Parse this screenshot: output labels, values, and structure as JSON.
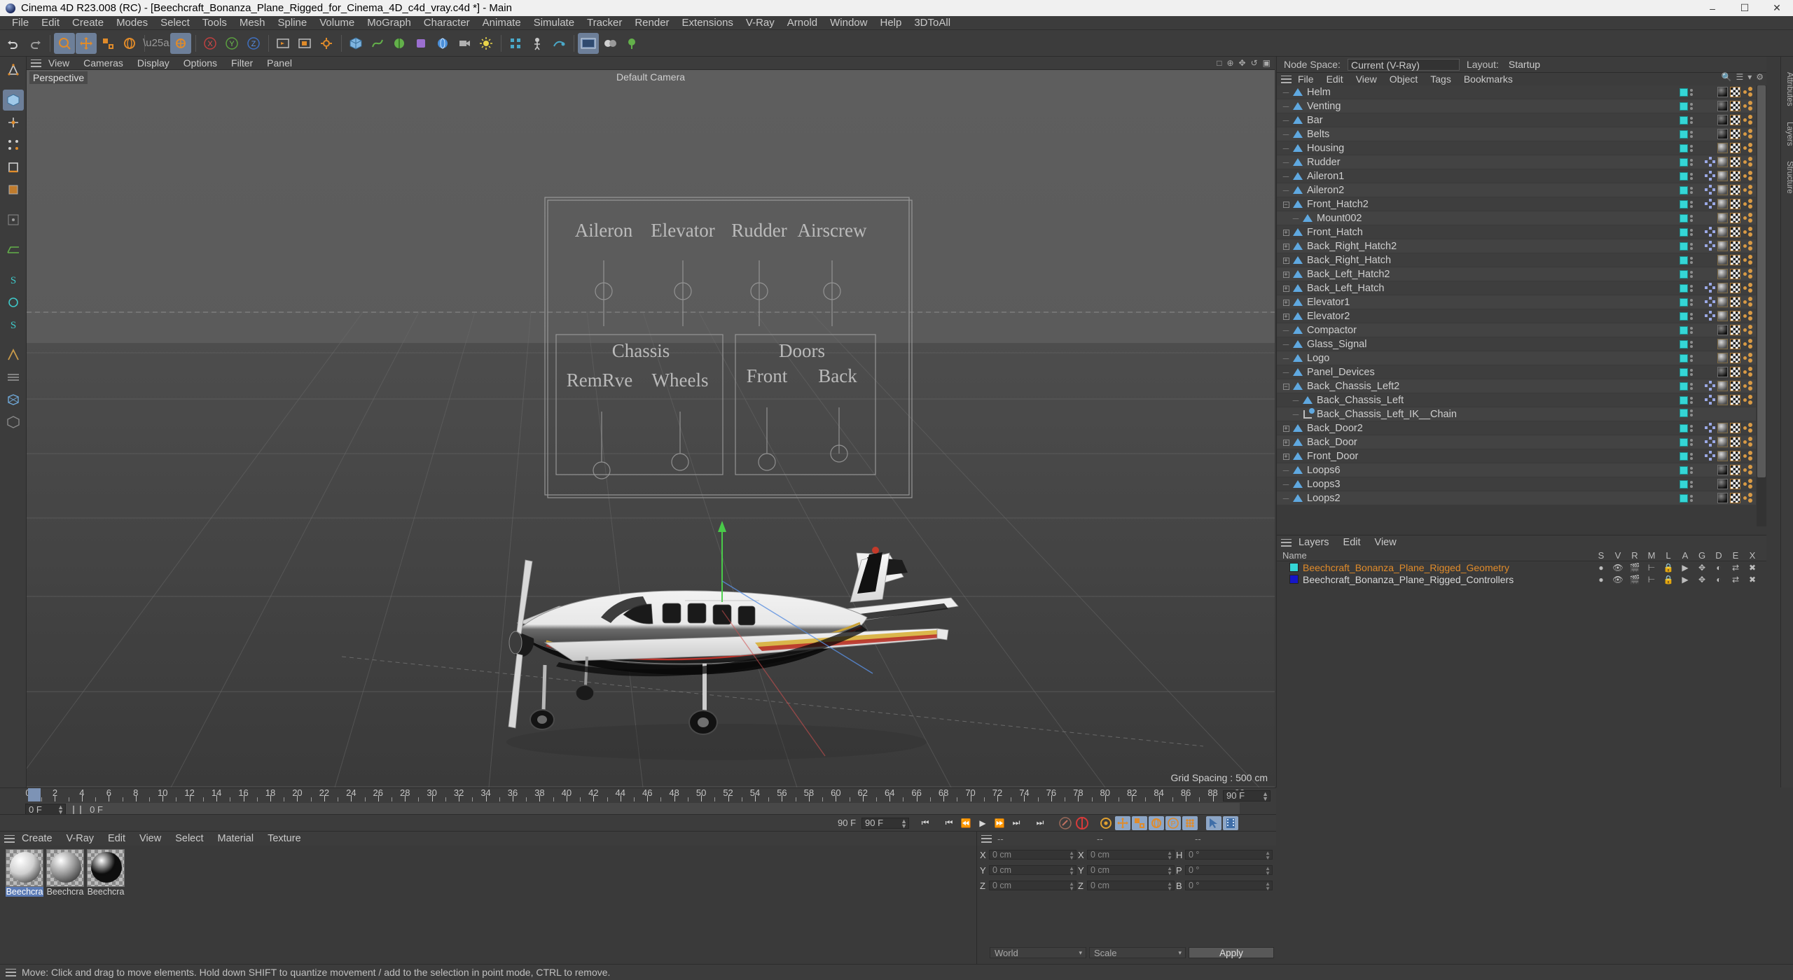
{
  "window": {
    "title": "Cinema 4D R23.008 (RC) - [Beechcraft_Bonanza_Plane_Rigged_for_Cinema_4D_c4d_vray.c4d *] - Main",
    "minimize": "–",
    "maximize": "☐",
    "close": "✕"
  },
  "menubar": {
    "items": [
      "File",
      "Edit",
      "Create",
      "Modes",
      "Select",
      "Tools",
      "Mesh",
      "Spline",
      "Volume",
      "MoGraph",
      "Character",
      "Animate",
      "Simulate",
      "Tracker",
      "Render",
      "Extensions",
      "V-Ray",
      "Arnold",
      "Window",
      "Help",
      "3DToAll"
    ]
  },
  "viewport": {
    "menu": [
      "View",
      "Cameras",
      "Display",
      "Options",
      "Filter",
      "Panel"
    ],
    "perspective_label": "Perspective",
    "camera_label": "Default Camera",
    "grid_spacing": "Grid Spacing : 500 cm",
    "hud_panels": {
      "controls_title_row": [
        "Aileron",
        "Elevator",
        "Rudder",
        "Airscrew"
      ],
      "chassis_title": "Chassis",
      "chassis_buttons": [
        "RemRve",
        "Wheels"
      ],
      "doors_title": "Doors",
      "doors_buttons": [
        "Front",
        "Back"
      ]
    }
  },
  "object_manager": {
    "menu": [
      "File",
      "Edit",
      "View",
      "Object",
      "Tags",
      "Bookmarks"
    ],
    "nodespace_label": "Node Space:",
    "nodespace_value": "Current (V-Ray)",
    "layout_label": "Layout:",
    "layout_value": "Startup",
    "items": [
      {
        "name": "Helm",
        "depth": 1,
        "expand": "none",
        "tags": [
          "matdark",
          "uv",
          "weight"
        ]
      },
      {
        "name": "Venting",
        "depth": 1,
        "expand": "none",
        "tags": [
          "matdark",
          "uv",
          "weight"
        ]
      },
      {
        "name": "Bar",
        "depth": 1,
        "expand": "none",
        "tags": [
          "matdark",
          "uv",
          "weight"
        ]
      },
      {
        "name": "Belts",
        "depth": 1,
        "expand": "none",
        "tags": [
          "matdark",
          "uv",
          "weight"
        ]
      },
      {
        "name": "Housing",
        "depth": 1,
        "expand": "none",
        "tags": [
          "mat",
          "uv",
          "weight"
        ]
      },
      {
        "name": "Rudder",
        "depth": 1,
        "expand": "none",
        "tags": [
          "vrt",
          "mat",
          "uv",
          "weight"
        ]
      },
      {
        "name": "Aileron1",
        "depth": 1,
        "expand": "none",
        "tags": [
          "vrt",
          "mat",
          "uv",
          "weight"
        ]
      },
      {
        "name": "Aileron2",
        "depth": 1,
        "expand": "none",
        "tags": [
          "vrt",
          "mat",
          "uv",
          "weight"
        ]
      },
      {
        "name": "Front_Hatch2",
        "depth": 1,
        "expand": "open",
        "tags": [
          "vrt",
          "mat",
          "uv",
          "weight"
        ]
      },
      {
        "name": "Mount002",
        "depth": 2,
        "expand": "none",
        "tags": [
          "mat",
          "uv",
          "weight"
        ]
      },
      {
        "name": "Front_Hatch",
        "depth": 1,
        "expand": "closed",
        "tags": [
          "vrt",
          "mat",
          "uv",
          "weight"
        ]
      },
      {
        "name": "Back_Right_Hatch2",
        "depth": 1,
        "expand": "closed",
        "tags": [
          "vrt",
          "mat",
          "uv",
          "weight"
        ]
      },
      {
        "name": "Back_Right_Hatch",
        "depth": 1,
        "expand": "closed",
        "tags": [
          "mat",
          "uv",
          "weight"
        ]
      },
      {
        "name": "Back_Left_Hatch2",
        "depth": 1,
        "expand": "closed",
        "tags": [
          "mat",
          "uv",
          "weight"
        ]
      },
      {
        "name": "Back_Left_Hatch",
        "depth": 1,
        "expand": "closed",
        "tags": [
          "vrt",
          "mat",
          "uv",
          "weight"
        ]
      },
      {
        "name": "Elevator1",
        "depth": 1,
        "expand": "closed",
        "tags": [
          "vrt",
          "mat",
          "uv",
          "weight"
        ]
      },
      {
        "name": "Elevator2",
        "depth": 1,
        "expand": "closed",
        "tags": [
          "vrt",
          "mat",
          "uv",
          "weight"
        ]
      },
      {
        "name": "Compactor",
        "depth": 1,
        "expand": "none",
        "tags": [
          "matdark",
          "uv",
          "weight"
        ]
      },
      {
        "name": "Glass_Signal",
        "depth": 1,
        "expand": "none",
        "tags": [
          "mat",
          "uv",
          "weight"
        ]
      },
      {
        "name": "Logo",
        "depth": 1,
        "expand": "none",
        "tags": [
          "mat",
          "uv",
          "weight"
        ]
      },
      {
        "name": "Panel_Devices",
        "depth": 1,
        "expand": "none",
        "tags": [
          "matdark",
          "uv",
          "weight"
        ]
      },
      {
        "name": "Back_Chassis_Left2",
        "depth": 1,
        "expand": "open",
        "tags": [
          "vrt",
          "mat",
          "uv",
          "weight"
        ]
      },
      {
        "name": "Back_Chassis_Left",
        "depth": 2,
        "expand": "none",
        "tags": [
          "vrt",
          "mat",
          "uv",
          "weight"
        ]
      },
      {
        "name": "Back_Chassis_Left_IK__Chain",
        "depth": 2,
        "expand": "none",
        "icon": "ik",
        "tags": []
      },
      {
        "name": "Back_Door2",
        "depth": 1,
        "expand": "closed",
        "tags": [
          "vrt",
          "mat",
          "uv",
          "weight"
        ]
      },
      {
        "name": "Back_Door",
        "depth": 1,
        "expand": "closed",
        "tags": [
          "vrt",
          "mat",
          "uv",
          "weight"
        ]
      },
      {
        "name": "Front_Door",
        "depth": 1,
        "expand": "closed",
        "tags": [
          "vrt",
          "mat",
          "uv",
          "weight"
        ]
      },
      {
        "name": "Loops6",
        "depth": 1,
        "expand": "none",
        "tags": [
          "matdark",
          "uv",
          "weight"
        ]
      },
      {
        "name": "Loops3",
        "depth": 1,
        "expand": "none",
        "tags": [
          "matdark",
          "uv",
          "weight"
        ]
      },
      {
        "name": "Loops2",
        "depth": 1,
        "expand": "none",
        "tags": [
          "matdark",
          "uv",
          "weight"
        ]
      }
    ]
  },
  "layer_manager": {
    "menu": [
      "Layers",
      "Edit",
      "View"
    ],
    "name_column": "Name",
    "columns": [
      "S",
      "V",
      "R",
      "M",
      "L",
      "A",
      "G",
      "D",
      "E",
      "X"
    ],
    "rows": [
      {
        "name": "Beechcraft_Bonanza_Plane_Rigged_Geometry",
        "color": "#35d6d6",
        "text_color": "#e08b2a"
      },
      {
        "name": "Beechcraft_Bonanza_Plane_Rigged_Controllers",
        "color": "#1616c8",
        "text_color": "#d8d8d8"
      }
    ]
  },
  "side_strip": {
    "labels": [
      "Attributes",
      "Layers",
      "Structure"
    ]
  },
  "timeline": {
    "ticks": [
      0,
      2,
      4,
      6,
      8,
      10,
      12,
      14,
      16,
      18,
      20,
      22,
      24,
      26,
      28,
      30,
      32,
      34,
      36,
      38,
      40,
      42,
      44,
      46,
      48,
      50,
      52,
      54,
      56,
      58,
      60,
      62,
      64,
      66,
      68,
      70,
      72,
      74,
      76,
      78,
      80,
      82,
      84,
      86,
      88,
      90
    ],
    "current_frame": "0 F",
    "start_field": "0 F",
    "preview_start": "0 F",
    "end_field": "90 F",
    "preview_end": "90 F",
    "range_end": "90 F"
  },
  "material_manager": {
    "menu": [
      "Create",
      "V-Ray",
      "Edit",
      "View",
      "Select",
      "Material",
      "Texture"
    ],
    "materials": [
      {
        "label": "Beechcra",
        "selected": true,
        "tone": "#cfcfcf"
      },
      {
        "label": "Beechcra",
        "selected": false,
        "tone": "#9a9a9a"
      },
      {
        "label": "Beechcra",
        "selected": false,
        "tone": "#0d0d0d"
      }
    ]
  },
  "coordinate_manager": {
    "headers": [
      "--",
      "--",
      "--"
    ],
    "position": {
      "labels": [
        "X",
        "Y",
        "Z"
      ],
      "values": [
        "0 cm",
        "0 cm",
        "0 cm"
      ]
    },
    "size": {
      "labels": [
        "X",
        "Y",
        "Z"
      ],
      "values": [
        "0 cm",
        "0 cm",
        "0 cm"
      ]
    },
    "rotation": {
      "labels": [
        "H",
        "P",
        "B"
      ],
      "values": [
        "0 °",
        "0 °",
        "0 °"
      ]
    },
    "coord_system": "World",
    "mode": "Scale",
    "apply_label": "Apply"
  },
  "statusbar": {
    "message": "Move: Click and drag to move elements. Hold down SHIFT to quantize movement / add to the selection in point mode, CTRL to remove."
  },
  "colors": {
    "accent_blue": "#6d7f99",
    "layer_cyan": "#35d6d6",
    "layer_blue": "#1616c8",
    "orange": "#e08b2a",
    "panel_bg": "#3a3a3a"
  }
}
